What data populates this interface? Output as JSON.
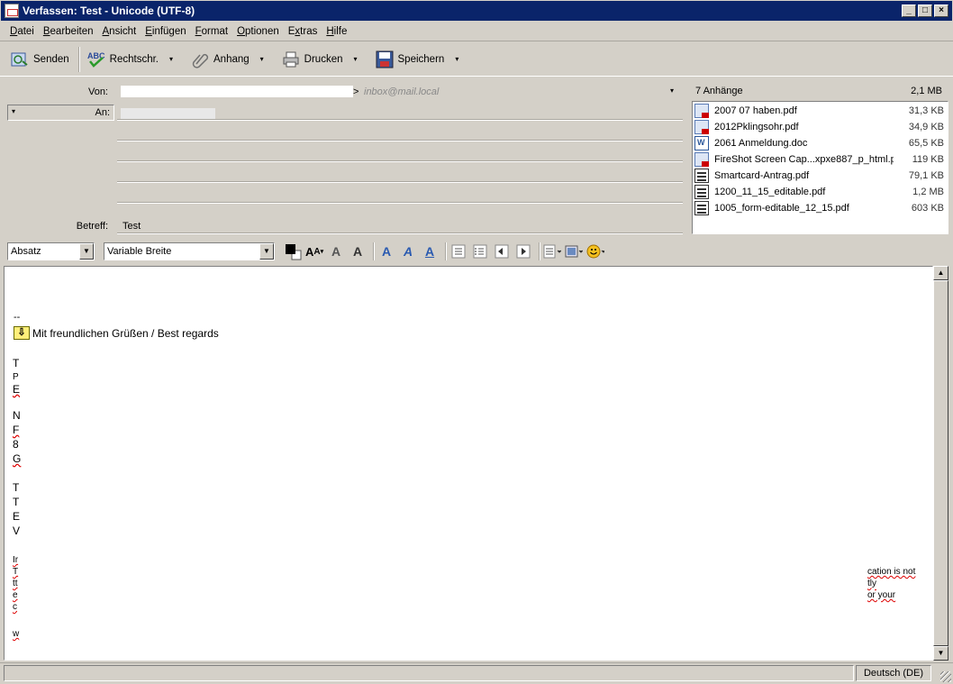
{
  "window": {
    "title": "Verfassen: Test - Unicode (UTF-8)",
    "controls": [
      "_",
      "□",
      "×"
    ]
  },
  "menu": [
    {
      "label": "Datei",
      "accel": "D"
    },
    {
      "label": "Bearbeiten",
      "accel": "B"
    },
    {
      "label": "Ansicht",
      "accel": "A"
    },
    {
      "label": "Einfügen",
      "accel": "E"
    },
    {
      "label": "Format",
      "accel": "F"
    },
    {
      "label": "Optionen",
      "accel": "O"
    },
    {
      "label": "Extras",
      "accel": "x"
    },
    {
      "label": "Hilfe",
      "accel": "H"
    }
  ],
  "toolbar": {
    "send_label": "Senden",
    "spell_label": "Rechtschr.",
    "attach_label": "Anhang",
    "print_label": "Drucken",
    "save_label": "Speichern"
  },
  "header": {
    "from_label": "Von:",
    "from_value": "inbox@mail.local",
    "to_label": "An:",
    "subject_label": "Betreff:",
    "subject_value": "Test"
  },
  "attachments": {
    "count_label": "7 Anhänge",
    "total_size": "2,1 MB",
    "items": [
      {
        "name": "2007 07 haben.pdf",
        "size": "31,3 KB",
        "icon": "pdf-icon"
      },
      {
        "name": "2012Pklingsohr.pdf",
        "size": "34,9 KB",
        "icon": "pdf-icon"
      },
      {
        "name": "2061 Anmeldung.doc",
        "size": "65,5 KB",
        "icon": "doc-icon"
      },
      {
        "name": "FireShot Screen Cap...xpxe887_p_html.pdf",
        "size": "119 KB",
        "icon": "pdf-icon"
      },
      {
        "name": "Smartcard-Antrag.pdf",
        "size": "79,1 KB",
        "icon": "form-icon"
      },
      {
        "name": "1200_11_15_editable.pdf",
        "size": "1,2 MB",
        "icon": "form-icon"
      },
      {
        "name": "1005_form-editable_12_15.pdf",
        "size": "603 KB",
        "icon": "form-icon"
      }
    ]
  },
  "format": {
    "paragraph_value": "Absatz",
    "font_value": "Variable Breite"
  },
  "editor": {
    "sig_separator": "--",
    "regards": "Mit freundlichen Grüßen / Best regards",
    "fragments_left": [
      "T",
      "P",
      "E",
      "N",
      "F",
      "8",
      "G",
      "T",
      "T",
      "E",
      "V",
      "Ir",
      "T",
      "tt",
      "e",
      "c",
      "w"
    ],
    "fragments_right": [
      "cation is not",
      "tly",
      "or your"
    ]
  },
  "status": {
    "language": "Deutsch (DE)"
  }
}
